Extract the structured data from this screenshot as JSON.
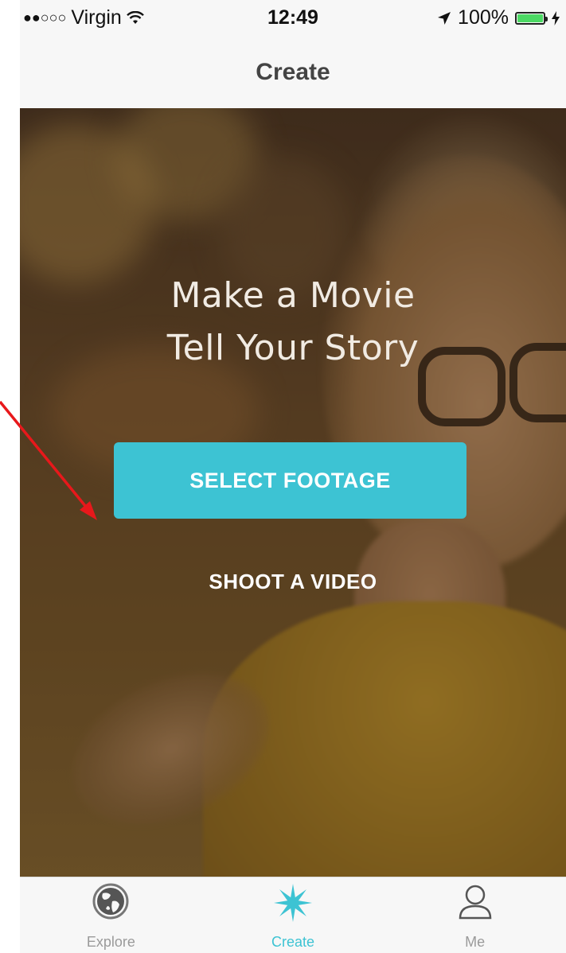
{
  "status_bar": {
    "signal_dots": "●●○○○",
    "carrier": "Virgin",
    "time": "12:49",
    "battery_percent_label": "100%",
    "battery_level": 1.0
  },
  "nav": {
    "title": "Create"
  },
  "hero": {
    "headline_line1": "Make a Movie",
    "headline_line2": "Tell Your Story",
    "select_button_label": "SELECT FOOTAGE",
    "shoot_link_label": "SHOOT A VIDEO"
  },
  "tabs": [
    {
      "label": "Explore",
      "icon": "globe-icon",
      "active": false
    },
    {
      "label": "Create",
      "icon": "starburst-icon",
      "active": true
    },
    {
      "label": "Me",
      "icon": "person-icon",
      "active": false
    }
  ],
  "colors": {
    "accent": "#3dc3d3",
    "annotation_arrow": "#e8181b",
    "battery_fill": "#4cd964"
  }
}
